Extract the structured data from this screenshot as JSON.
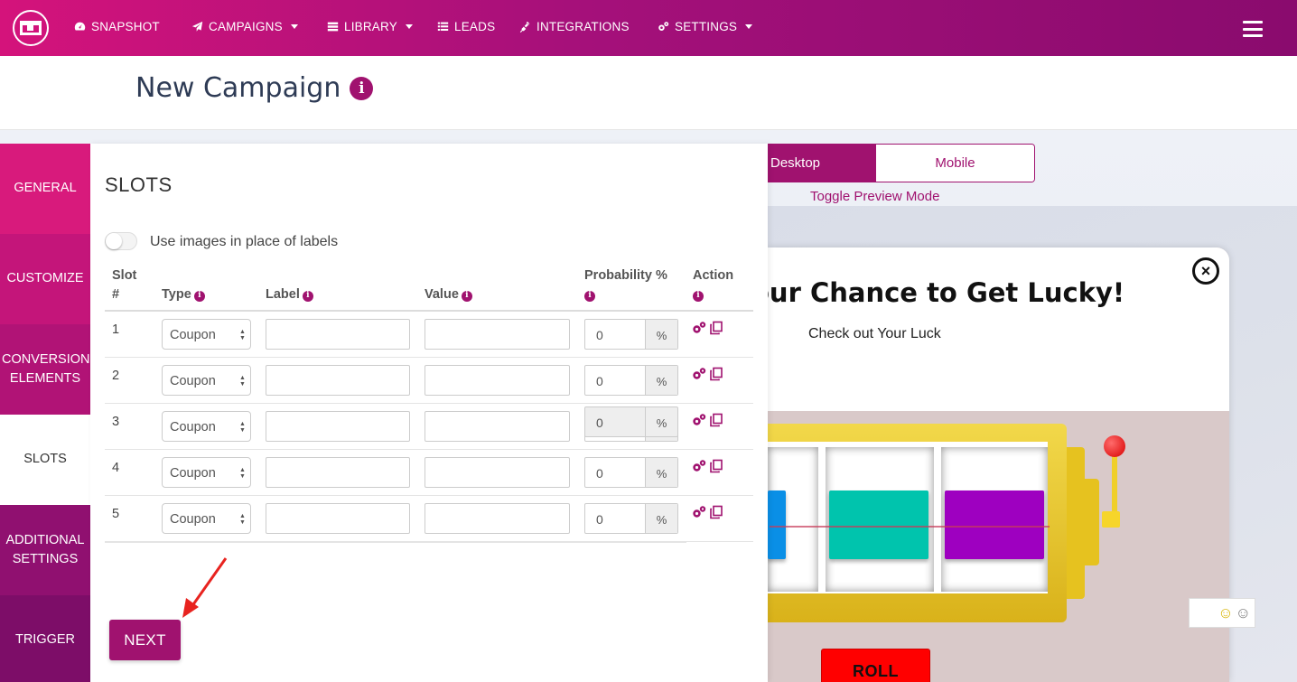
{
  "nav": {
    "items": [
      {
        "label": "SNAPSHOT",
        "icon": "dashboard-icon"
      },
      {
        "label": "CAMPAIGNS",
        "icon": "paper-plane-icon",
        "dropdown": true
      },
      {
        "label": "LIBRARY",
        "icon": "server-icon",
        "dropdown": true
      },
      {
        "label": "LEADS",
        "icon": "list-icon"
      },
      {
        "label": "INTEGRATIONS",
        "icon": "plug-icon"
      },
      {
        "label": "SETTINGS",
        "icon": "gears-icon",
        "dropdown": true
      }
    ]
  },
  "header": {
    "title": "New Campaign"
  },
  "sidebar": {
    "items": [
      {
        "label": "GENERAL"
      },
      {
        "label": "CUSTOMIZE"
      },
      {
        "label": "CONVERSION ELEMENTS"
      },
      {
        "label": "SLOTS",
        "active": true
      },
      {
        "label": "ADDITIONAL SETTINGS"
      },
      {
        "label": "TRIGGER"
      }
    ]
  },
  "panel": {
    "title": "SLOTS",
    "toggle_label": "Use images in place of labels",
    "toggle_on": false,
    "columns": {
      "slot": "Slot #",
      "type": "Type",
      "label": "Label",
      "value": "Value",
      "probability": "Probability %",
      "action": "Action"
    },
    "rows": [
      {
        "num": "1",
        "type": "Coupon",
        "label": "",
        "value": "",
        "probability": "0",
        "unit": "%"
      },
      {
        "num": "2",
        "type": "Coupon",
        "label": "",
        "value": "",
        "probability": "0",
        "unit": "%"
      },
      {
        "num": "3",
        "type": "Coupon",
        "label": "",
        "value": "",
        "probability": "0",
        "unit": "%"
      },
      {
        "num": "4",
        "type": "Coupon",
        "label": "",
        "value": "",
        "probability": "0",
        "unit": "%"
      },
      {
        "num": "5",
        "type": "Coupon",
        "label": "",
        "value": "",
        "probability": "0",
        "unit": "%"
      }
    ],
    "total": {
      "value": "0",
      "unit": "%"
    },
    "next_label": "NEXT"
  },
  "preview": {
    "desktop_label": "Desktop",
    "mobile_label": "Mobile",
    "caption": "Toggle Preview Mode",
    "popup_title": "our Chance to Get Lucky!",
    "popup_subtitle": "Check out Your Luck",
    "roll_label": "ROLL",
    "close_glyph": "×",
    "reel_colors": [
      "#0a8fe6",
      "#00c4ad",
      "#9e00c0"
    ]
  },
  "colors": {
    "brand": "#a0126f",
    "nav_start": "#d4137b",
    "nav_end": "#8a0b6e"
  }
}
